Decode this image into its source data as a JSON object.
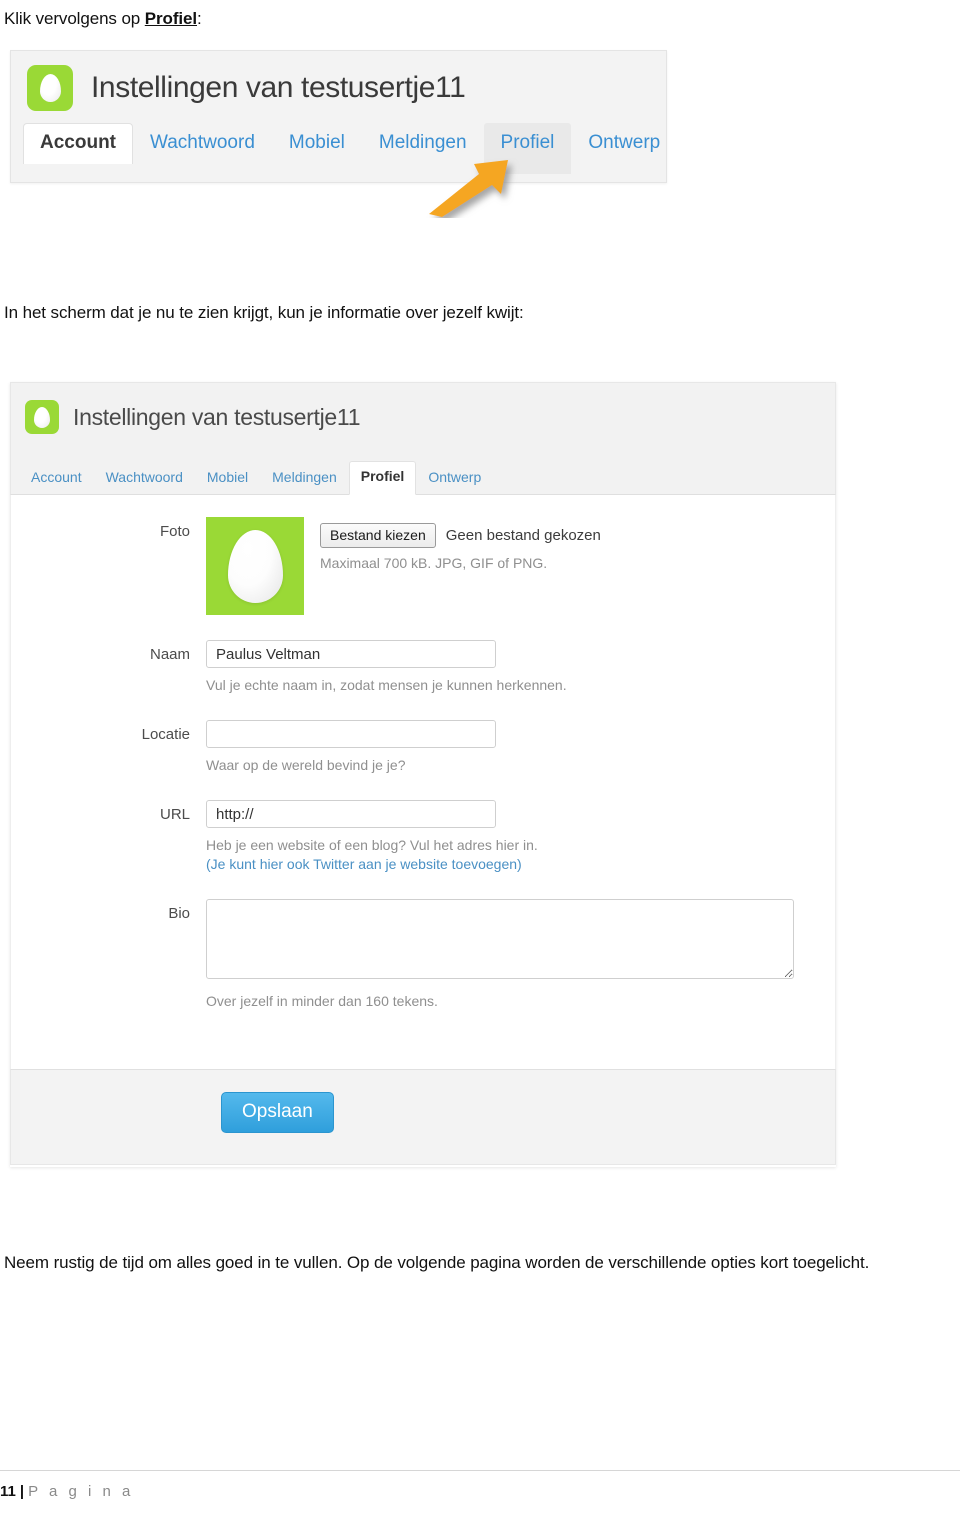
{
  "document": {
    "intro_line": {
      "before": "Klik vervolgens op ",
      "emphasis": "Profiel",
      "after": ":"
    },
    "mid_line": "In het scherm dat je nu te zien krijgt, kun je informatie over jezelf kwijt:",
    "closing_paragraph": "Neem rustig de tijd om alles goed in te vullen. Op de volgende pagina worden de verschillende opties kort toegelicht."
  },
  "footer": {
    "page_number": "11",
    "separator": "|",
    "word": "P a g i n a"
  },
  "screenshot_one": {
    "title": "Instellingen van testusertje11",
    "avatar_icon": "egg-avatar-icon",
    "tabs": [
      {
        "label": "Account",
        "state": "active"
      },
      {
        "label": "Wachtwoord",
        "state": "normal"
      },
      {
        "label": "Mobiel",
        "state": "normal"
      },
      {
        "label": "Meldingen",
        "state": "normal"
      },
      {
        "label": "Profiel",
        "state": "hovered"
      },
      {
        "label": "Ontwerp",
        "state": "normal"
      }
    ],
    "annotation": {
      "icon": "orange-arrow-icon",
      "points_at": "Profiel",
      "color": "#F5A623"
    }
  },
  "screenshot_two": {
    "title": "Instellingen van testusertje11",
    "avatar_icon": "egg-avatar-icon",
    "tabs": [
      {
        "label": "Account",
        "state": "normal"
      },
      {
        "label": "Wachtwoord",
        "state": "normal"
      },
      {
        "label": "Mobiel",
        "state": "normal"
      },
      {
        "label": "Meldingen",
        "state": "normal"
      },
      {
        "label": "Profiel",
        "state": "active"
      },
      {
        "label": "Ontwerp",
        "state": "normal"
      }
    ],
    "form": {
      "photo": {
        "label": "Foto",
        "choose_button": "Bestand kiezen",
        "no_file_text": "Geen bestand gekozen",
        "hint": "Maximaal 700 kB. JPG, GIF of PNG."
      },
      "name": {
        "label": "Naam",
        "value": "Paulus Veltman",
        "placeholder": "",
        "hint": "Vul je echte naam in, zodat mensen je kunnen herkennen."
      },
      "location": {
        "label": "Locatie",
        "value": "",
        "placeholder": "",
        "hint": "Waar op de wereld bevind je je?"
      },
      "url": {
        "label": "URL",
        "value": "http://",
        "placeholder": "http://",
        "hint": "Heb je een website of een blog? Vul het adres hier in.",
        "link_text": "(Je kunt hier ook Twitter aan je website toevoegen)"
      },
      "bio": {
        "label": "Bio",
        "value": "",
        "placeholder": "",
        "hint": "Over jezelf in minder dan 160 tekens."
      },
      "save_button": "Opslaan"
    },
    "colors": {
      "avatar_green": "#9AD936",
      "link_blue": "#4A90C4",
      "save_blue": "#2F9FDC",
      "panel_gray": "#F2F2F2"
    }
  }
}
